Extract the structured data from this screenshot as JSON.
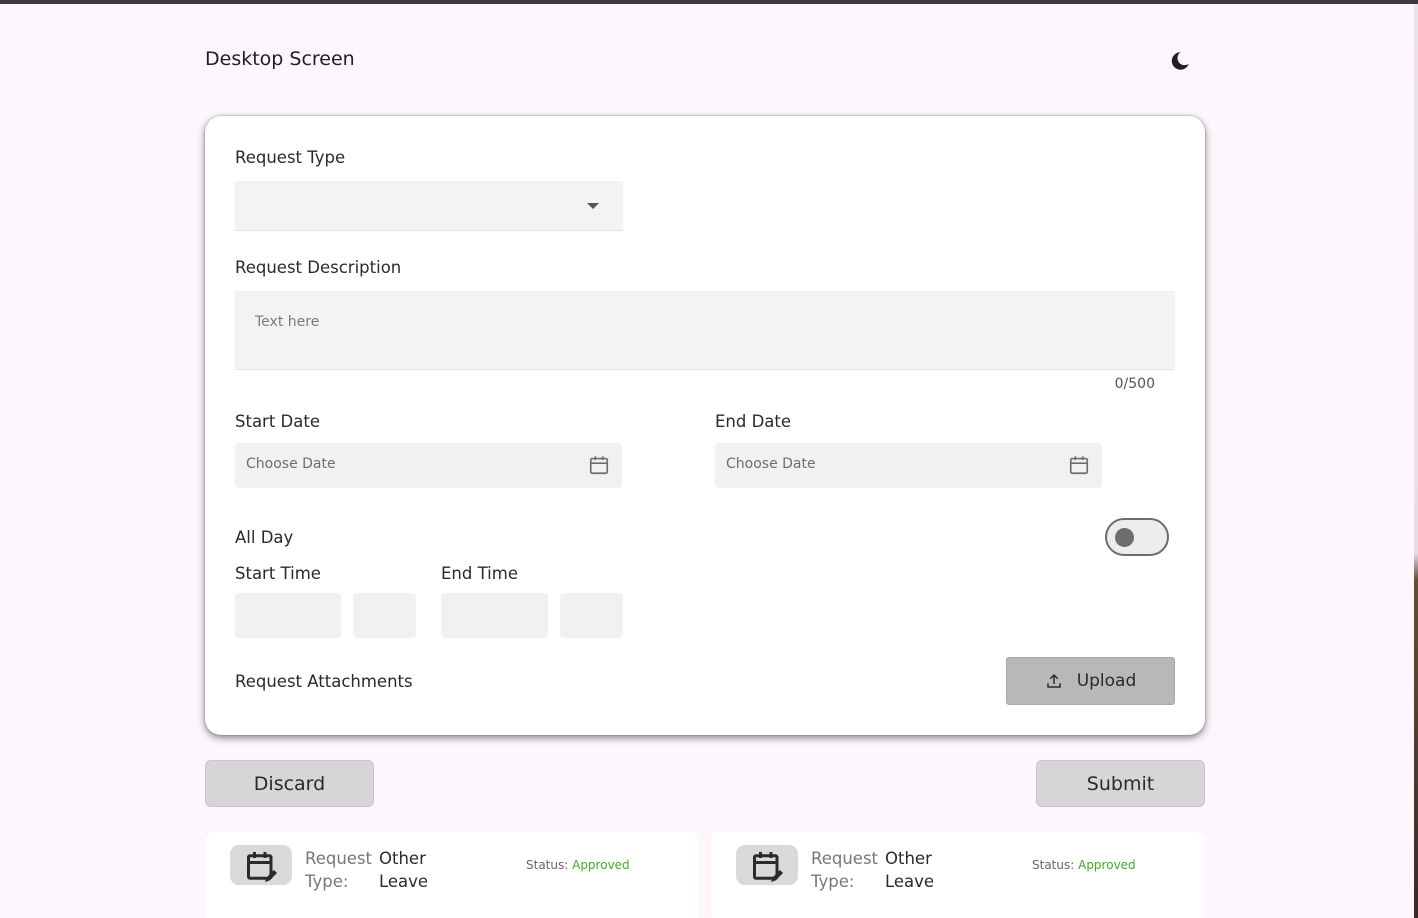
{
  "header": {
    "title": "Desktop Screen",
    "theme_icon": "moon-icon"
  },
  "form": {
    "request_type_label": "Request Type",
    "request_type_value": "",
    "description_label": "Request Description",
    "description_placeholder": "Text here",
    "description_counter": "0/500",
    "start_date_label": "Start Date",
    "start_date_placeholder": "Choose Date",
    "end_date_label": "End Date",
    "end_date_placeholder": "Choose Date",
    "all_day_label": "All Day",
    "all_day_on": false,
    "start_time_label": "Start Time",
    "end_time_label": "End Time",
    "attachments_label": "Request Attachments",
    "upload_label": "Upload"
  },
  "actions": {
    "discard_label": "Discard",
    "submit_label": "Submit"
  },
  "requests": [
    {
      "type_label": "Request Type:",
      "type_value": "Other Leave",
      "status_label": "Status:",
      "status_value": "Approved"
    },
    {
      "type_label": "Request Type:",
      "type_value": "Other Leave",
      "status_label": "Status:",
      "status_value": "Approved"
    }
  ],
  "colors": {
    "background": "#fdf6fc",
    "status_approved": "#3fae2a",
    "button_bg": "#d8d5d9",
    "upload_bg": "#b8b8b8"
  }
}
